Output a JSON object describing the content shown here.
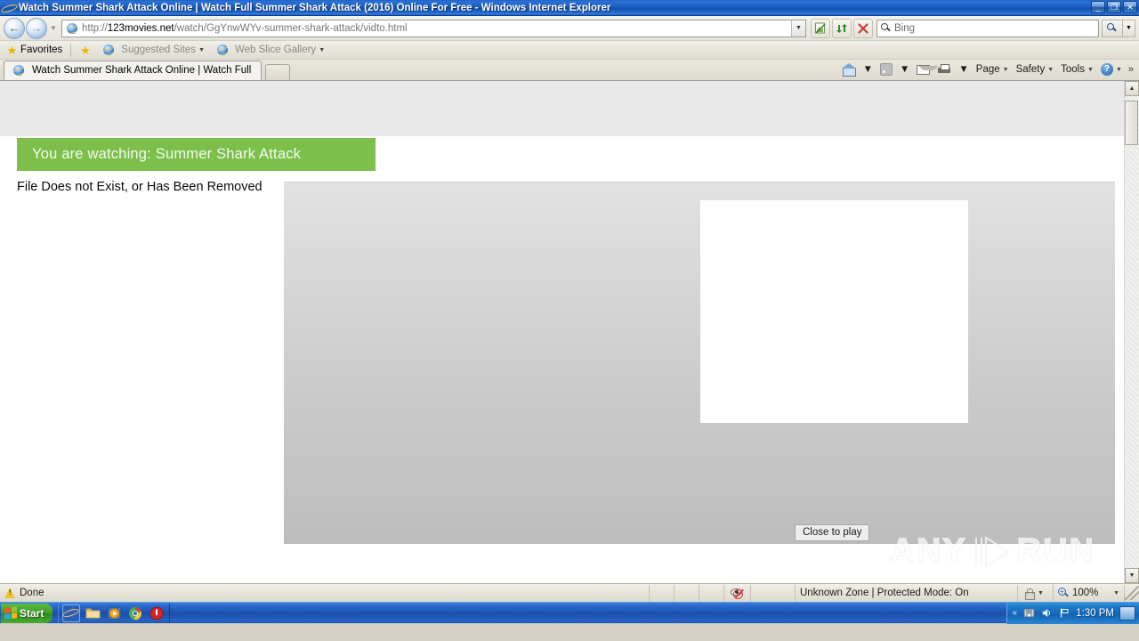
{
  "window": {
    "title": "Watch Summer Shark Attack Online | Watch Full Summer Shark Attack (2016) Online For Free - Windows Internet Explorer",
    "minimize_label": "_",
    "maximize_label": "❐",
    "close_label": "✕"
  },
  "nav": {
    "back_label": "←",
    "forward_label": "→",
    "history_caret": "▼",
    "address_prefix": "http://",
    "address_domain": "123movies.net",
    "address_suffix": "/watch/GgYnwWYv-summer-shark-attack/vidto.html",
    "address_dropdown": "▼",
    "compatibility_title": "Compatibility View",
    "refresh_label": "↻",
    "stop_label": "✕",
    "search_placeholder": "Bing",
    "search_go_label": "Search",
    "search_dropdown": "▼"
  },
  "favorites_bar": {
    "favorites_label": "Favorites",
    "items": [
      {
        "label": "Suggested Sites",
        "caret": "▼"
      },
      {
        "label": "Web Slice Gallery",
        "caret": "▼"
      }
    ]
  },
  "tabs": {
    "items": [
      {
        "label": "Watch Summer Shark Attack Online | Watch Full Sum..."
      }
    ],
    "new_tab_label": ""
  },
  "command_bar": {
    "home_label": "",
    "home_caret": "▼",
    "feeds_label": "",
    "feeds_caret": "▼",
    "mail_label": "",
    "print_label": "",
    "print_caret": "▼",
    "page_label": "Page",
    "page_caret": "▼",
    "safety_label": "Safety",
    "safety_caret": "▼",
    "tools_label": "Tools",
    "tools_caret": "▼",
    "help_label": "?",
    "help_caret": "▼",
    "overflow_label": "»"
  },
  "page": {
    "banner_text": "You are watching: Summer Shark Attack",
    "banner_color": "#7cc04b",
    "error_text": "File Does not Exist, or Has Been Removed",
    "close_to_play_label": "Close to play",
    "watermark_left": "ANY",
    "watermark_right": "RUN"
  },
  "scrollbar": {
    "up_label": "▲",
    "down_label": "▼"
  },
  "statusbar": {
    "status_text": "Done",
    "zone_text": "Unknown Zone | Protected Mode: On",
    "zone_caret": "▼",
    "zoom_level": "100%",
    "zoom_caret": "▼"
  },
  "taskbar": {
    "start_label": "Start",
    "clock": "1:30 PM",
    "tray_chevron": "«",
    "apps": [
      {
        "name": "internet-explorer"
      },
      {
        "name": "windows-explorer"
      },
      {
        "name": "media-player"
      },
      {
        "name": "google-chrome"
      },
      {
        "name": "red-shield-app"
      }
    ]
  }
}
